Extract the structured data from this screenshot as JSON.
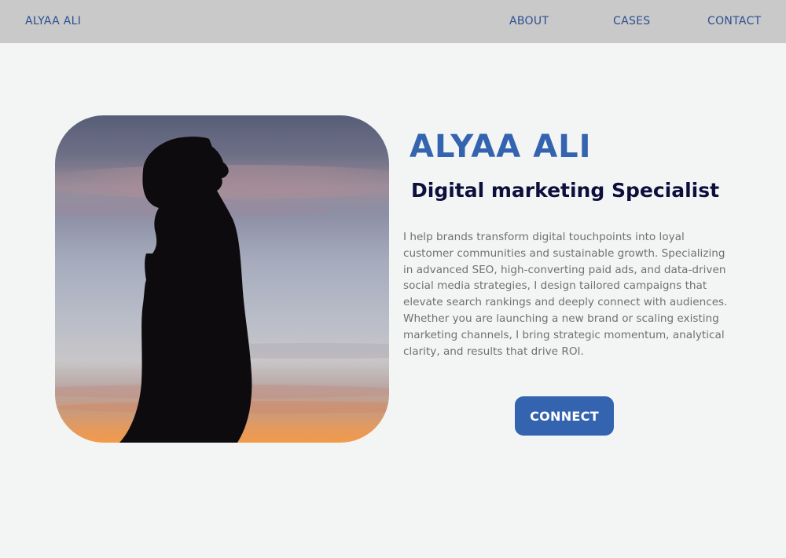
{
  "nav": {
    "brand": "ALYAA ALI",
    "links": [
      "ABOUT",
      "CASES",
      "CONTACT"
    ]
  },
  "hero": {
    "name": "ALYAA ALI",
    "title": "Digital marketing Specialist",
    "bio": "I help brands transform digital touchpoints into loyal customer communities and sustainable growth. Specializing in advanced SEO, high-converting paid ads, and data-driven social media strategies, I design tailored campaigns that elevate search rankings and deeply connect with audiences. Whether you are launching a new brand or scaling existing marketing channels, I bring strategic momentum, analytical clarity, and results that drive ROI.",
    "cta_label": "CONNECT",
    "photo_icon": "silhouette-photo"
  },
  "colors": {
    "topbar": "#c9c9c9",
    "accent": "#3464b0",
    "title": "#0c0f3b",
    "body_text": "#707070",
    "page_bg": "#f3f5f5"
  }
}
